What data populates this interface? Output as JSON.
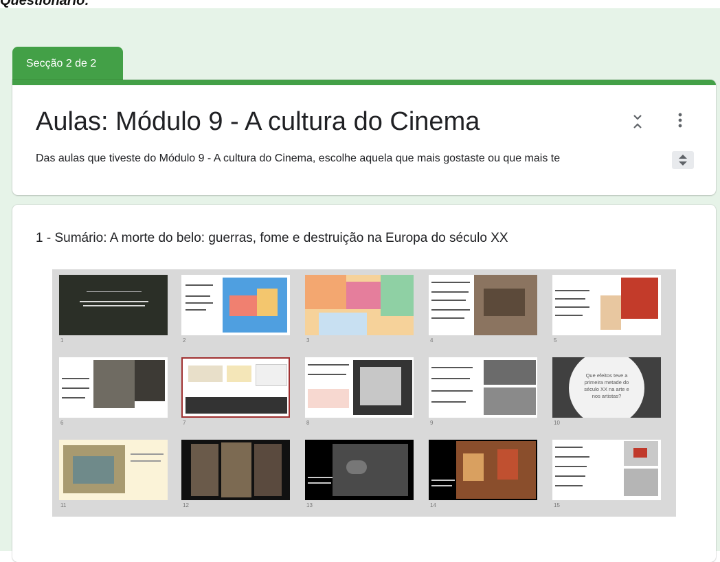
{
  "page": {
    "top_label": "Questionário:"
  },
  "section": {
    "tab_label": "Secção 2 de 2"
  },
  "header": {
    "title": "Aulas: Módulo 9 - A cultura do Cinema",
    "description": "Das aulas que tiveste do Módulo 9 - A cultura do Cinema, escolhe aquela que mais gostaste ou que mais te"
  },
  "icons": {
    "collapse": "collapse-icon",
    "more": "more-vert-icon",
    "spinner": "spinner-icon"
  },
  "question": {
    "title": "1 - Sumário: A morte do belo: guerras, fome e destruição na Europa do século XX",
    "slides": [
      {
        "num": "1"
      },
      {
        "num": "2"
      },
      {
        "num": "3"
      },
      {
        "num": "4"
      },
      {
        "num": "5"
      },
      {
        "num": "6"
      },
      {
        "num": "7"
      },
      {
        "num": "8"
      },
      {
        "num": "9"
      },
      {
        "num": "10",
        "text": "Que efeitos teve a primeira metade do século XX na arte e nos artistas?"
      },
      {
        "num": "11"
      },
      {
        "num": "12"
      },
      {
        "num": "13"
      },
      {
        "num": "14"
      },
      {
        "num": "15"
      }
    ]
  },
  "colors": {
    "accent": "#43a047",
    "page_bg": "#e6f3e8",
    "selected_border": "#a03030"
  }
}
